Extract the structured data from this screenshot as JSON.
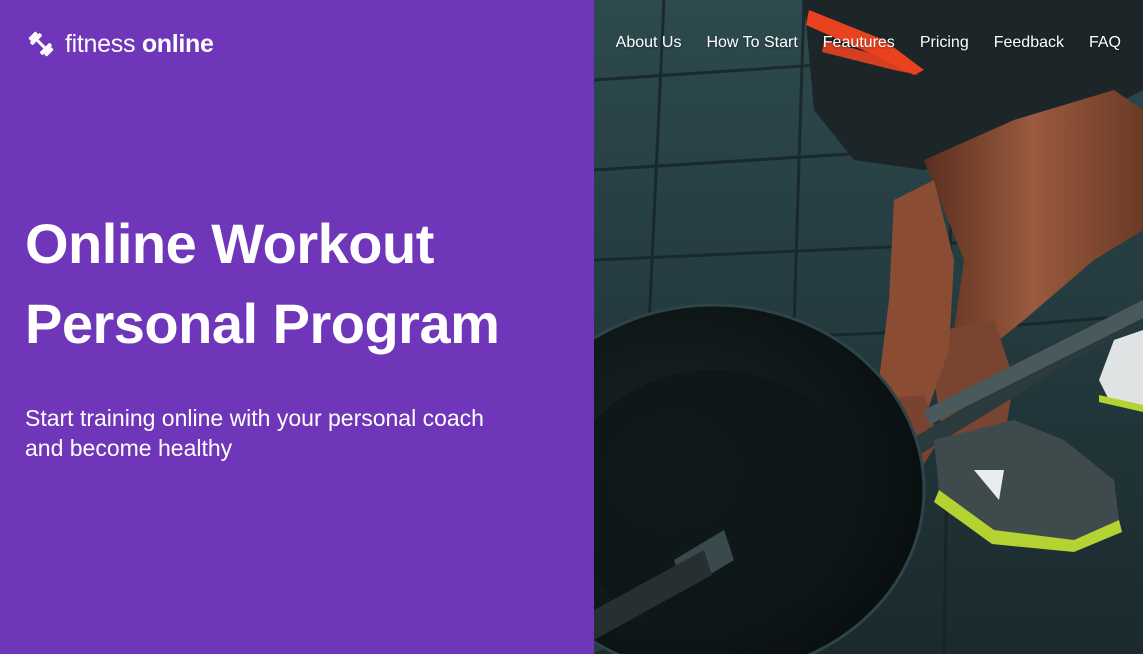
{
  "brand": {
    "name_light": "fitness",
    "name_bold": "online",
    "icon": "dumbbell-icon"
  },
  "nav": {
    "items": [
      {
        "label": "About Us"
      },
      {
        "label": "How To Start"
      },
      {
        "label": "Feautures"
      },
      {
        "label": "Pricing"
      },
      {
        "label": "Feedback"
      },
      {
        "label": "FAQ"
      }
    ]
  },
  "hero": {
    "title_line1": "Online Workout",
    "title_line2": "Personal Program",
    "subtitle_line1": "Start training online with your personal coach",
    "subtitle_line2": "and become healthy"
  },
  "colors": {
    "brand_purple": "#6f36b9",
    "text": "#ffffff",
    "accent_orange": "#e8421f",
    "shoe_green": "#b5d233"
  }
}
